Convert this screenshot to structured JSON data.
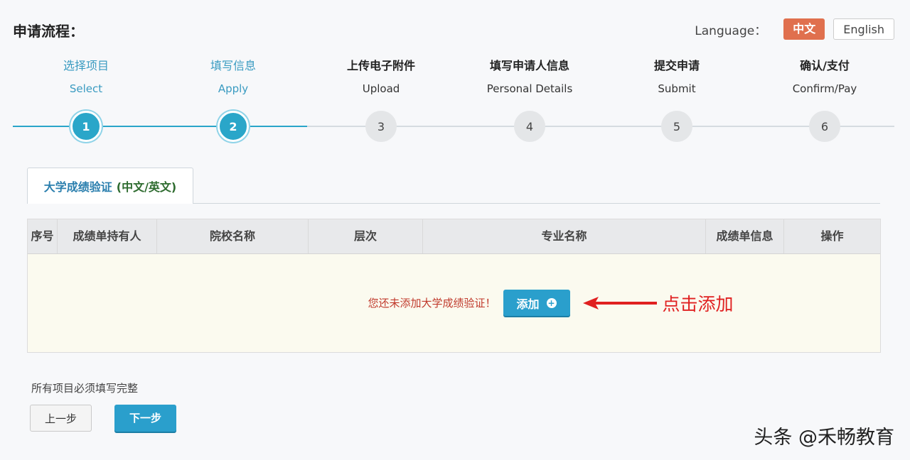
{
  "header": {
    "title": "申请流程：",
    "language_label": "Language：",
    "lang_cn": "中文",
    "lang_en": "English"
  },
  "steps": [
    {
      "cn": "选择项目",
      "en": "Select",
      "num": "1",
      "state": "done"
    },
    {
      "cn": "填写信息",
      "en": "Apply",
      "num": "2",
      "state": "done"
    },
    {
      "cn": "上传电子附件",
      "en": "Upload",
      "num": "3",
      "state": "todo"
    },
    {
      "cn": "填写申请人信息",
      "en": "Personal Details",
      "num": "4",
      "state": "todo"
    },
    {
      "cn": "提交申请",
      "en": "Submit",
      "num": "5",
      "state": "todo"
    },
    {
      "cn": "确认/支付",
      "en": "Confirm/Pay",
      "num": "6",
      "state": "todo"
    }
  ],
  "tab": {
    "label": "大学成绩验证",
    "sub": "(中文/英文)"
  },
  "table": {
    "headers": [
      "序号",
      "成绩单持有人",
      "院校名称",
      "层次",
      "专业名称",
      "成绩单信息",
      "操作"
    ],
    "empty_message": "您还未添加大学成绩验证！",
    "add_button": "添加",
    "annotation": "点击添加"
  },
  "footer": {
    "note": "所有项目必须填写完整",
    "prev": "上一步",
    "next": "下一步"
  },
  "watermark": "头条 @禾畅教育",
  "colors": {
    "accent": "#2aa6c9",
    "lang_active": "#e0704e",
    "warning": "#c0392b",
    "annotation": "#e02020"
  }
}
